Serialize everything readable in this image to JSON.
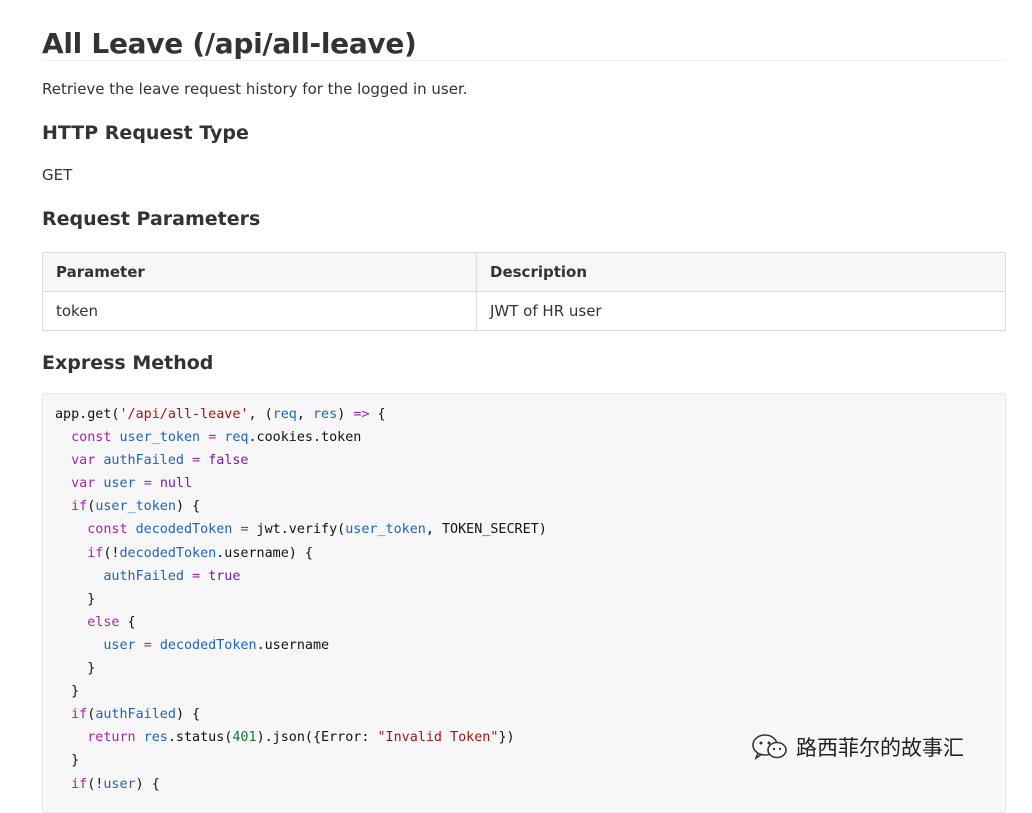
{
  "doc": {
    "title": "All Leave (/api/all-leave)",
    "intro": "Retrieve the leave request history for the logged in user.",
    "section_type": "HTTP Request Type",
    "method": "GET",
    "section_params": "Request Parameters",
    "section_express": "Express Method"
  },
  "params_table": {
    "headers": [
      "Parameter",
      "Description"
    ],
    "rows": [
      [
        "token",
        "JWT of HR user"
      ]
    ]
  },
  "code": [
    [
      [
        "t",
        "app.get("
      ],
      [
        "str",
        "'/api/all-leave'"
      ],
      [
        "t",
        ", ("
      ],
      [
        "id",
        "req"
      ],
      [
        "t",
        ", "
      ],
      [
        "id",
        "res"
      ],
      [
        "t",
        ") "
      ],
      [
        "arrow",
        "=>"
      ],
      [
        "t",
        " {"
      ]
    ],
    [
      [
        "t",
        "  "
      ],
      [
        "kw",
        "const"
      ],
      [
        "t",
        " "
      ],
      [
        "id",
        "user_token"
      ],
      [
        "t",
        " "
      ],
      [
        "kw",
        "="
      ],
      [
        "t",
        " "
      ],
      [
        "id",
        "req"
      ],
      [
        "t",
        ".cookies.token"
      ]
    ],
    [
      [
        "t",
        "  "
      ],
      [
        "kw",
        "var"
      ],
      [
        "t",
        " "
      ],
      [
        "id",
        "authFailed"
      ],
      [
        "t",
        " "
      ],
      [
        "kw",
        "="
      ],
      [
        "t",
        " "
      ],
      [
        "kw2",
        "false"
      ]
    ],
    [
      [
        "t",
        "  "
      ],
      [
        "kw",
        "var"
      ],
      [
        "t",
        " "
      ],
      [
        "id",
        "user"
      ],
      [
        "t",
        " "
      ],
      [
        "kw",
        "="
      ],
      [
        "t",
        " "
      ],
      [
        "kw2",
        "null"
      ]
    ],
    [
      [
        "t",
        "  "
      ],
      [
        "kw",
        "if"
      ],
      [
        "t",
        "("
      ],
      [
        "id",
        "user_token"
      ],
      [
        "t",
        ") {"
      ]
    ],
    [
      [
        "t",
        "    "
      ],
      [
        "kw",
        "const"
      ],
      [
        "t",
        " "
      ],
      [
        "id",
        "decodedToken"
      ],
      [
        "t",
        " "
      ],
      [
        "kw",
        "="
      ],
      [
        "t",
        " jwt.verify("
      ],
      [
        "id",
        "user_token"
      ],
      [
        "t",
        ", TOKEN_SECRET)"
      ]
    ],
    [
      [
        "t",
        "    "
      ],
      [
        "kw",
        "if"
      ],
      [
        "t",
        "(!"
      ],
      [
        "id",
        "decodedToken"
      ],
      [
        "t",
        ".username) {"
      ]
    ],
    [
      [
        "t",
        "      "
      ],
      [
        "id",
        "authFailed"
      ],
      [
        "t",
        " "
      ],
      [
        "kw",
        "="
      ],
      [
        "t",
        " "
      ],
      [
        "kw2",
        "true"
      ]
    ],
    [
      [
        "t",
        "    }"
      ]
    ],
    [
      [
        "t",
        "    "
      ],
      [
        "kw",
        "else"
      ],
      [
        "t",
        " {"
      ]
    ],
    [
      [
        "t",
        "      "
      ],
      [
        "id",
        "user"
      ],
      [
        "t",
        " "
      ],
      [
        "kw",
        "="
      ],
      [
        "t",
        " "
      ],
      [
        "id",
        "decodedToken"
      ],
      [
        "t",
        ".username"
      ]
    ],
    [
      [
        "t",
        "    }"
      ]
    ],
    [
      [
        "t",
        "  }"
      ]
    ],
    [
      [
        "t",
        "  "
      ],
      [
        "kw",
        "if"
      ],
      [
        "t",
        "("
      ],
      [
        "id",
        "authFailed"
      ],
      [
        "t",
        ") {"
      ]
    ],
    [
      [
        "t",
        "    "
      ],
      [
        "kw",
        "return"
      ],
      [
        "t",
        " "
      ],
      [
        "id",
        "res"
      ],
      [
        "t",
        ".status("
      ],
      [
        "num",
        "401"
      ],
      [
        "t",
        ").json({Error: "
      ],
      [
        "str",
        "\"Invalid Token\""
      ],
      [
        "t",
        "})"
      ]
    ],
    [
      [
        "t",
        "  }"
      ]
    ],
    [
      [
        "t",
        "  "
      ],
      [
        "kw",
        "if"
      ],
      [
        "t",
        "(!"
      ],
      [
        "id",
        "user"
      ],
      [
        "t",
        ") {"
      ]
    ]
  ],
  "watermark": {
    "text": "路西菲尔的故事汇",
    "icon": "wechat-icon"
  }
}
